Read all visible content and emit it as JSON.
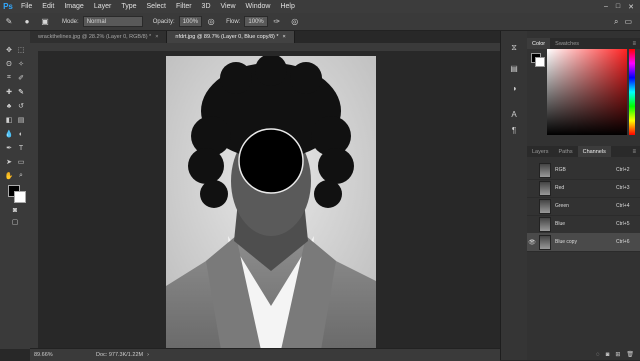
{
  "app": {
    "logo": "Ps"
  },
  "menu": [
    "File",
    "Edit",
    "Image",
    "Layer",
    "Type",
    "Select",
    "Filter",
    "3D",
    "View",
    "Window",
    "Help"
  ],
  "options": {
    "mode_label": "Mode:",
    "mode_value": "Normal",
    "opacity_label": "Opacity:",
    "opacity_value": "100%",
    "flow_label": "Flow:",
    "flow_value": "100%"
  },
  "tabs": [
    {
      "label": "wrackthelines.jpg @ 28.2% (Layer 0, RGB/8) *",
      "close": "×"
    },
    {
      "label": "nfdrt.jpg @ 89.7% (Layer 0, Blue copy/8) *",
      "close": "×"
    }
  ],
  "status": {
    "zoom": "89.66%",
    "doc": "Doc: 977.3K/1.22M"
  },
  "panels": {
    "color_tabs": [
      "Color",
      "Swatches"
    ],
    "lower_tabs": [
      "Layers",
      "Paths",
      "Channels"
    ],
    "channels": [
      {
        "name": "RGB",
        "shortcut": "Ctrl+2"
      },
      {
        "name": "Red",
        "shortcut": "Ctrl+3"
      },
      {
        "name": "Green",
        "shortcut": "Ctrl+4"
      },
      {
        "name": "Blue",
        "shortcut": "Ctrl+5"
      },
      {
        "name": "Blue copy",
        "shortcut": "Ctrl+6"
      }
    ]
  },
  "colors": {
    "accent": "#31a8ff",
    "panel": "#323232",
    "selected_row": "#4a4a4a"
  }
}
